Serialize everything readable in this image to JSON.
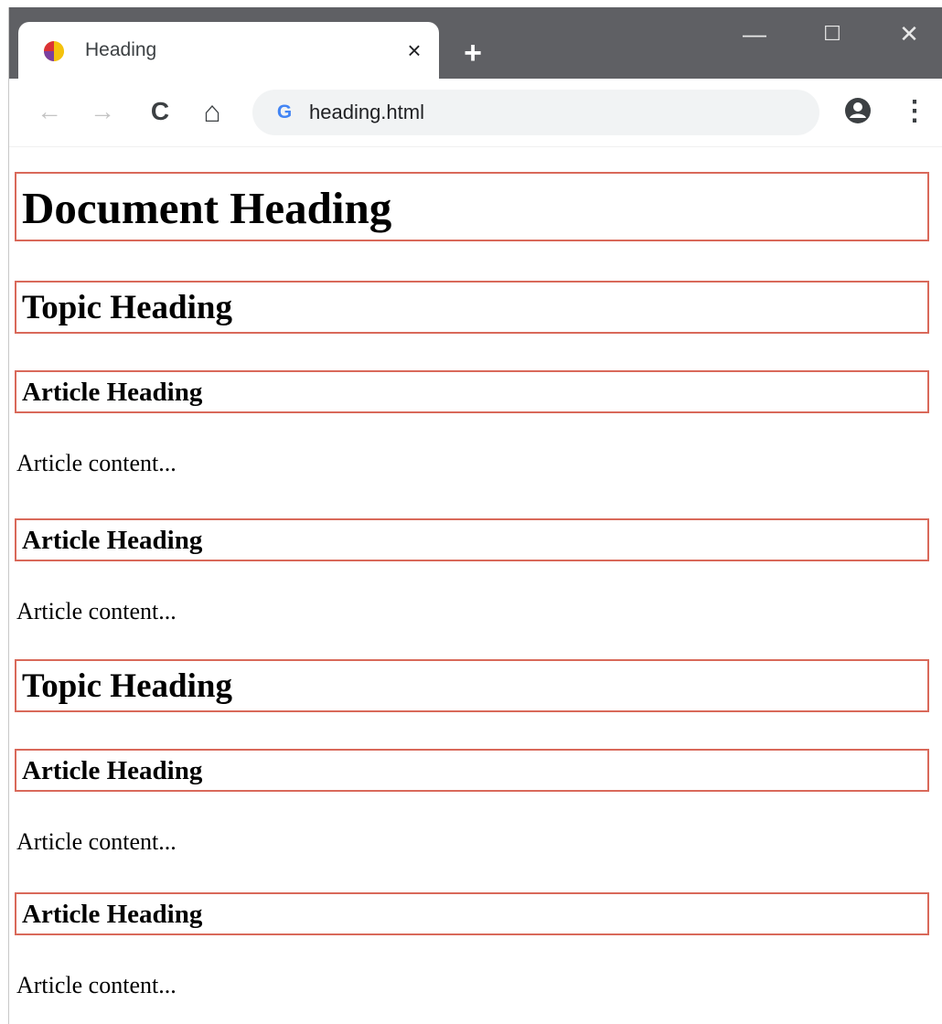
{
  "browser": {
    "tab_title": "Heading",
    "tab_close": "×",
    "new_tab": "+",
    "url": "heading.html",
    "controls": {
      "minimize": "—",
      "maximize": "☐",
      "close": "✕"
    },
    "nav": {
      "back": "←",
      "forward": "→",
      "reload": "C",
      "home": "⌂",
      "menu": "⋮"
    },
    "search_engine_glyph": "G"
  },
  "page": {
    "document_heading": "Document Heading",
    "topics": [
      {
        "heading": "Topic Heading",
        "articles": [
          {
            "heading": "Article Heading",
            "content": "Article content..."
          },
          {
            "heading": "Article Heading",
            "content": "Article content..."
          }
        ]
      },
      {
        "heading": "Topic Heading",
        "articles": [
          {
            "heading": "Article Heading",
            "content": "Article content..."
          },
          {
            "heading": "Article Heading",
            "content": "Article content..."
          }
        ]
      }
    ]
  },
  "colors": {
    "heading_border": "#d9695a",
    "titlebar": "#5f6064",
    "omnibox": "#f1f3f4"
  }
}
